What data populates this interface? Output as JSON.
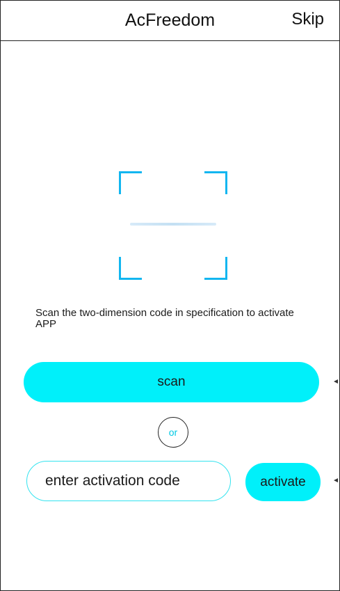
{
  "header": {
    "title": "AcFreedom",
    "skip_label": "Skip"
  },
  "scanner": {
    "corner_color": "#12b6f0"
  },
  "instruction": {
    "text": "Scan the two-dimension code in specification to activate APP"
  },
  "scan_button": {
    "label": "scan",
    "color": "#00f0fa"
  },
  "divider": {
    "label": "or"
  },
  "activation": {
    "placeholder": "enter activation code",
    "button_label": "activate"
  }
}
